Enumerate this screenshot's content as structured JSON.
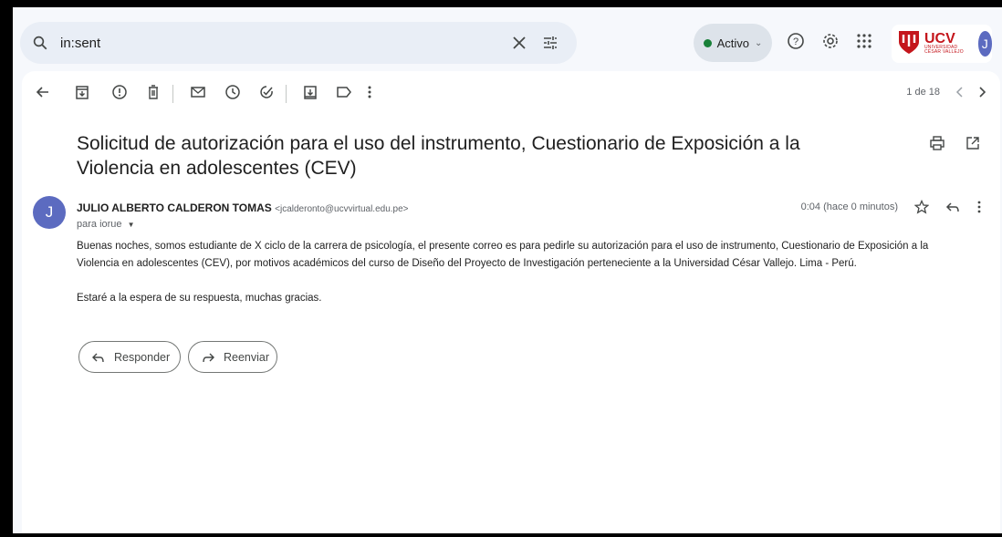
{
  "search": {
    "query": "in:sent"
  },
  "status": {
    "label": "Activo",
    "color": "#188038"
  },
  "brand": {
    "logo": "UCV",
    "sub": "UNIVERSIDAD CÉSAR VALLEJO"
  },
  "account": {
    "initial": "J"
  },
  "toolbar": {
    "pager": "1 de 18",
    "icons": [
      "back-arrow-icon",
      "archive-icon",
      "report-spam-icon",
      "delete-icon",
      "mark-unread-icon",
      "snooze-icon",
      "add-task-icon",
      "move-to-icon",
      "label-icon",
      "more-vert-icon"
    ]
  },
  "email": {
    "subject": "Solicitud de autorización para el uso del instrumento, Cuestionario de Exposición a la Violencia en adolescentes (CEV)",
    "sender_initial": "J",
    "sender_name": "JULIO ALBERTO CALDERON TOMAS",
    "sender_email": "<jcalderonto@ucvvirtual.edu.pe>",
    "to": "para iorue",
    "time": "0:04 (hace 0 minutos)",
    "body_p1": "Buenas noches, somos estudiante de X ciclo de la carrera de psicología, el presente correo es para pedirle su autorización para el uso de instrumento, Cuestionario de Exposición a la Violencia en adolescentes (CEV), por motivos académicos del curso de Diseño del Proyecto de Investigación perteneciente a la Universidad César Vallejo. Lima - Perú.",
    "body_p2": "Estaré a la espera de su respuesta, muchas gracias."
  },
  "actions": {
    "reply": "Responder",
    "forward": "Reenviar"
  }
}
